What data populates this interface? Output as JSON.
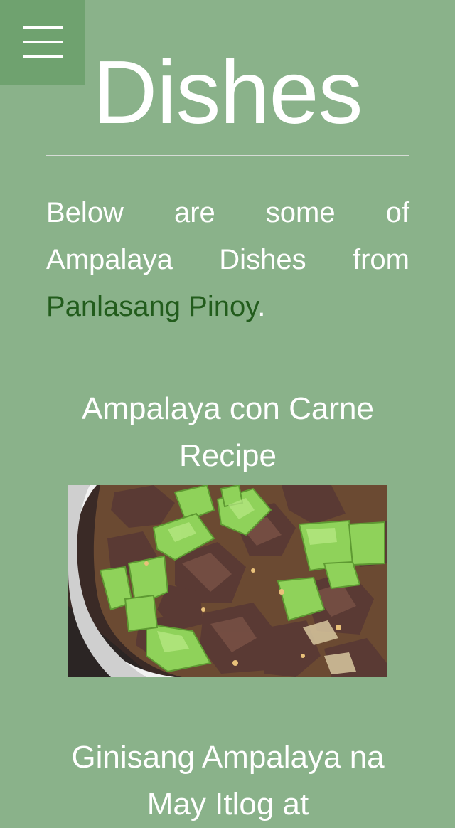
{
  "menu": {
    "icon": "hamburger-menu-icon"
  },
  "page": {
    "title": "Dishes"
  },
  "intro": {
    "text_before": "Below are some of Ampalaya Dishes from ",
    "link_text": "Panlasang Pinoy",
    "text_after": "."
  },
  "colors": {
    "background": "#8ab28a",
    "menu_background": "#6fa26f",
    "link": "#225c1c",
    "text": "#ffffff"
  },
  "dishes": [
    {
      "title": "Ampalaya con Carne Recipe",
      "photo": "ampalaya-con-carne-photo"
    },
    {
      "title": "Ginisang Ampalaya na May Itlog at"
    }
  ]
}
